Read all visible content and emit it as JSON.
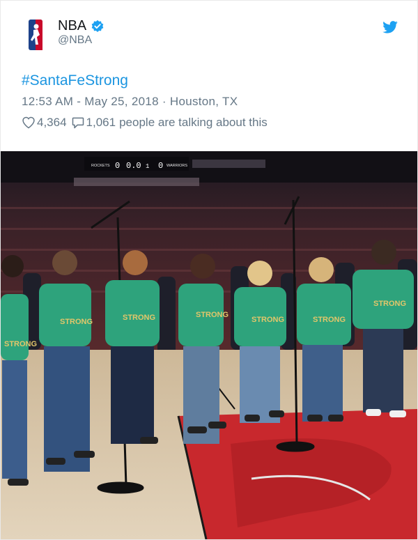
{
  "tweet": {
    "author_name": "NBA",
    "handle": "@NBA",
    "hashtag": "#SantaFeStrong",
    "time": "12:53 AM",
    "date": "May 25, 2018",
    "location": "Houston, TX",
    "likes": "4,364",
    "replies": "1,061",
    "talking_text": "people are talking about this"
  },
  "photo": {
    "scoreboard": {
      "home_team": "ROCKETS",
      "home_score": "0",
      "clock": "0.0",
      "period": "1",
      "away_score": "0",
      "away_team": "WARRIORS"
    },
    "shirt_text": "STRONG"
  },
  "colors": {
    "link_blue": "#1b95e0",
    "muted_gray": "#657786",
    "shirt_green": "#2ea37c",
    "court_red": "#c8282d",
    "court_wood": "#d6c4a8"
  },
  "icons": [
    "nba-logo-icon",
    "verified-badge-icon",
    "twitter-bird-icon",
    "heart-icon",
    "reply-bubble-icon"
  ]
}
